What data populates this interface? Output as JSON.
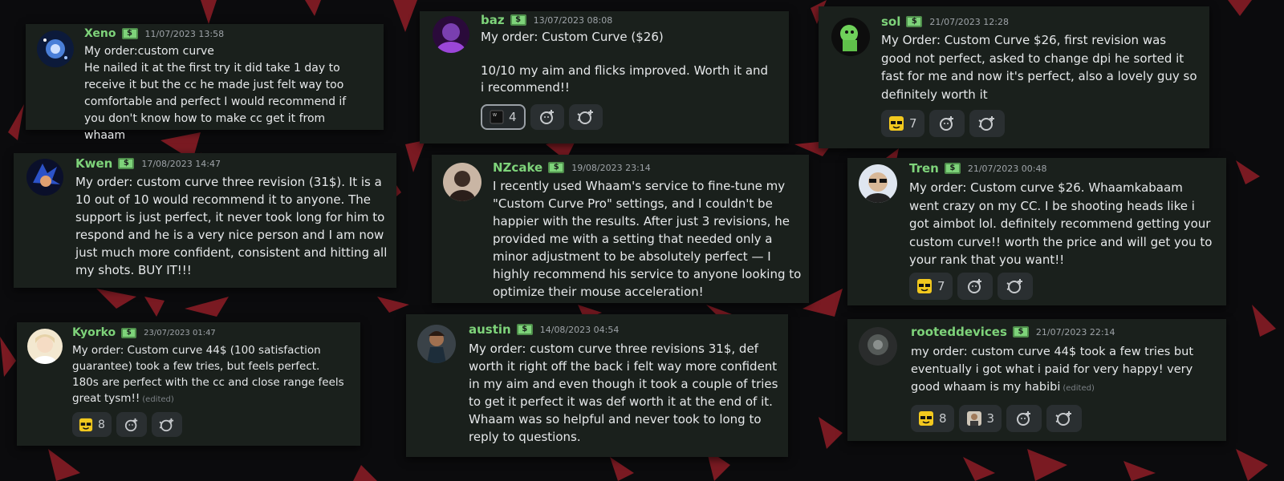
{
  "colors": {
    "background": "#0b0b0d",
    "accent_shards": "#7a1a22",
    "card": "#1a201c",
    "username": "#7ed37a",
    "timestamp": "#9ea3a8",
    "message_text": "#e6e8ea",
    "reaction_bg": "#2a2f31"
  },
  "reviews": [
    {
      "username": "Xeno",
      "badge": "$",
      "timestamp": "11/07/2023 13:58",
      "text": "My order:custom curve\nHe nailed it at the first try it did take 1 day to receive it but the cc he made just felt way too comfortable and perfect I would recommend if you don't know how to make cc get it from whaam",
      "edited": "",
      "reactions": [],
      "avatar_icon": "space-avatar-icon"
    },
    {
      "username": "baz",
      "badge": "$",
      "timestamp": "13/07/2023 08:08",
      "text": "My order: Custom Curve ($26)\n\n10/10 my aim and flicks improved. Worth it and i recommend!!",
      "edited": "",
      "reactions": [
        {
          "emoji": "w-keycap-emoji",
          "count": "4",
          "active": true
        },
        {
          "emoji": "add-reaction-icon",
          "count": ""
        },
        {
          "emoji": "add-super-reaction-icon",
          "count": ""
        }
      ],
      "avatar_icon": "purple-avatar-icon"
    },
    {
      "username": "sol",
      "badge": "$",
      "timestamp": "21/07/2023 12:28",
      "text": "My Order: Custom Curve $26, first revision was good not perfect, asked to change dpi he sorted it fast for me and now it's perfect, also a lovely guy so definitely worth it",
      "edited": "",
      "reactions": [
        {
          "emoji": "sunglasses-emoji",
          "count": "7"
        },
        {
          "emoji": "add-reaction-icon",
          "count": ""
        },
        {
          "emoji": "add-super-reaction-icon",
          "count": ""
        }
      ],
      "avatar_icon": "green-character-avatar-icon"
    },
    {
      "username": "Kwen",
      "badge": "$",
      "timestamp": "17/08/2023 14:47",
      "text": "My order: custom curve three revision (31$). It is a 10 out of 10 would recommend it to anyone. The support is just perfect, it never took long for him to respond and he is a very nice person and I am now just much more confident, consistent and hitting all my shots. BUY IT!!!",
      "edited": "",
      "reactions": [],
      "avatar_icon": "sonic-avatar-icon"
    },
    {
      "username": "NZcake",
      "badge": "$",
      "timestamp": "19/08/2023 23:14",
      "text": "I recently used Whaam's service to fine-tune my \"Custom Curve Pro\" settings, and I couldn't be happier with the results. After just 3 revisions, he provided me with a setting that needed only a minor adjustment to be absolutely perfect — I highly recommend his service to anyone looking to optimize their mouse acceleration!",
      "edited": "",
      "reactions": [],
      "avatar_icon": "portrait-avatar-icon"
    },
    {
      "username": "Tren",
      "badge": "$",
      "timestamp": "21/07/2023 00:48",
      "text": "My order: Custom curve $26. Whaamkabaam went crazy on my CC. I be shooting heads like i got aimbot lol. definitely recommend getting your custom curve!! worth the price and will get you to your rank that you want!!",
      "edited": "",
      "reactions": [
        {
          "emoji": "sunglasses-emoji",
          "count": "7"
        },
        {
          "emoji": "add-reaction-icon",
          "count": ""
        },
        {
          "emoji": "add-super-reaction-icon",
          "count": ""
        }
      ],
      "avatar_icon": "sunglasses-avatar-icon"
    },
    {
      "username": "Kyorko",
      "badge": "$",
      "timestamp": "23/07/2023 01:47",
      "text": "My order: Custom curve 44$ (100 satisfaction guarantee) took a few tries, but feels perfect. 180s are perfect with the cc and close range feels great tysm!!",
      "edited": "(edited)",
      "reactions": [
        {
          "emoji": "sunglasses-emoji",
          "count": "8"
        },
        {
          "emoji": "add-reaction-icon",
          "count": ""
        },
        {
          "emoji": "add-super-reaction-icon",
          "count": ""
        }
      ],
      "avatar_icon": "anime-avatar-icon"
    },
    {
      "username": "austin",
      "badge": "$",
      "timestamp": "14/08/2023 04:54",
      "text": "My order: custom curve three revisions 31$, def worth it right off the back i felt way more confident in my aim and even though it took a couple of tries to get it perfect it was def worth it at the end of it. Whaam was so helpful and never took to long to reply to questions.",
      "edited": "",
      "reactions": [],
      "avatar_icon": "character-avatar-icon"
    },
    {
      "username": "rooteddevices",
      "badge": "$",
      "timestamp": "21/07/2023 22:14",
      "text": "my order: custom curve 44$ took a few tries but eventually i got what i paid for very happy! very good whaam is my habibi",
      "edited": "(edited)",
      "reactions": [
        {
          "emoji": "sunglasses-emoji",
          "count": "8"
        },
        {
          "emoji": "person-emoji",
          "count": "3"
        },
        {
          "emoji": "add-reaction-icon",
          "count": ""
        },
        {
          "emoji": "add-super-reaction-icon",
          "count": ""
        }
      ],
      "avatar_icon": "dark-avatar-icon"
    }
  ]
}
